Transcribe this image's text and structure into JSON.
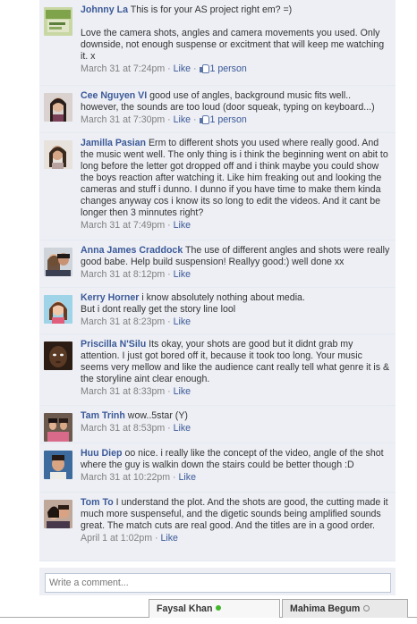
{
  "comments": [
    {
      "author": "Johnny La",
      "body": "This is for your AS project right em? =)\n\nLove the camera shots, angles and camera movements you used. Only downside, not enough suspense or excitment that will keep me watching it. x",
      "time": "March 31 at 7:24pm",
      "like": "Like",
      "likes_count": "1 person"
    },
    {
      "author": "Cee Nguyen VI",
      "body": "good use of angles, background music fits well.. however, the sounds are too loud (door squeak, typing on keyboard...)",
      "time": "March 31 at 7:30pm",
      "like": "Like",
      "likes_count": "1 person"
    },
    {
      "author": "Jamilla Pasian",
      "body": "Erm to different shots you used where really good. And the music went well. The only thing is i think the beginning went on abit to long before the letter got dropped off and i think maybe you could show the boys reaction after watching it. Like him freaking out and looking the cameras and stuff i dunno. I dunno if you have time to make them kinda changes anyway cos i know its so long to edit the videos. And it cant be longer then 3 minnutes right?",
      "time": "March 31 at 7:49pm",
      "like": "Like",
      "likes_count": ""
    },
    {
      "author": "Anna James Craddock",
      "body": "The use of different angles and shots were really good babe. Help build suspension! Reallyy good:) well done xx",
      "time": "March 31 at 8:12pm",
      "like": "Like",
      "likes_count": ""
    },
    {
      "author": "Kerry Horner",
      "body": "i know absolutely nothing about media.\nBut i dont really get the story line lool",
      "time": "March 31 at 8:23pm",
      "like": "Like",
      "likes_count": ""
    },
    {
      "author": "Priscilla N'Silu",
      "body": "Its okay, your shots are good but it didnt grab my attention. I just got bored off it, because it took too long. Your music seems very mellow and like the audience cant really tell what genre it is & the storyline aint clear enough.",
      "time": "March 31 at 8:33pm",
      "like": "Like",
      "likes_count": ""
    },
    {
      "author": "Tam Trinh",
      "body": "wow..5star (Y)",
      "time": "March 31 at 8:53pm",
      "like": "Like",
      "likes_count": ""
    },
    {
      "author": "Huu Diep",
      "body": "oo nice. i really like the concept of the video, angle of the shot where the guy is walkin down the stairs could be better though :D",
      "time": "March 31 at 10:22pm",
      "like": "Like",
      "likes_count": ""
    },
    {
      "author": "Tom To",
      "body": "I understand the plot. And the shots are good, the cutting made it much more suspenseful, and the digetic sounds being amplified sounds great. The match cuts are real good. And the titles are in a good order.",
      "time": "April 1 at 1:02pm",
      "like": "Like",
      "likes_count": ""
    }
  ],
  "write_comment": {
    "placeholder": "Write a comment..."
  },
  "chat": {
    "tabs": [
      {
        "name": "Faysal Khan",
        "status": "online"
      },
      {
        "name": "Mahima Begum",
        "status": "idle"
      }
    ]
  },
  "colors": {
    "link": "#3b5998",
    "comment_bg": "#edeff4",
    "meta_text": "#808080",
    "online": "#42b72a"
  },
  "separators": {
    "meta": " · "
  }
}
